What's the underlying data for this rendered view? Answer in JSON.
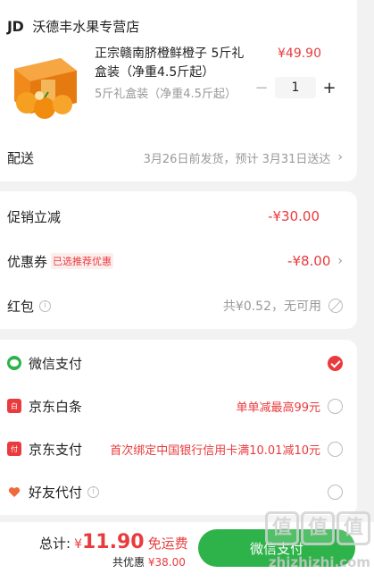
{
  "store": {
    "logo": "JD",
    "name": "沃德丰水果专营店"
  },
  "product": {
    "title": "正宗赣南脐橙鲜橙子 5斤礼盒装（净重4.5斤起）",
    "spec": "5斤礼盒装（净重4.5斤起）",
    "price": "¥49.90",
    "quantity": "1",
    "minus": "−",
    "plus": "+"
  },
  "delivery": {
    "label": "配送",
    "value": "3月26日前发货，预计 3月31日送达",
    "chevron": "›"
  },
  "promo": {
    "discount_label": "促销立减",
    "discount_value": "-¥30.00",
    "coupon_label": "优惠券",
    "coupon_tag": "已选推荐优惠",
    "coupon_value": "-¥8.00",
    "redpacket_label": "红包",
    "redpacket_value": "共¥0.52，无可用",
    "info": "i",
    "chevron": "›"
  },
  "payment": {
    "methods": [
      {
        "label": "微信支付",
        "promo": "",
        "icon": "wechat-pay-icon",
        "color": "#2eb34a",
        "selected": true
      },
      {
        "label": "京东白条",
        "promo": "单单减最高99元",
        "icon": "jd-baitiao-icon",
        "color": "#e93b3d",
        "selected": false
      },
      {
        "label": "京东支付",
        "promo": "首次绑定中国银行信用卡满10.01减10元",
        "icon": "jd-pay-icon",
        "color": "#e93b3d",
        "selected": false
      },
      {
        "label": "好友代付",
        "promo": "",
        "icon": "friend-pay-icon",
        "color": "#ef6a3a",
        "selected": false
      }
    ]
  },
  "bottom": {
    "total_label": "总计:",
    "currency": "¥",
    "total_amount": "11.90",
    "free_shipping": "免运费",
    "saving_prefix": "共优惠",
    "saving_value": "¥38.00",
    "submit_label": "微信支付"
  },
  "watermark": {
    "glyphs": [
      "值",
      "值",
      "值"
    ],
    "url": "zhizhizhi.com"
  },
  "colors": {
    "accent_red": "#e93b3d",
    "wechat_green": "#2eb34a"
  }
}
